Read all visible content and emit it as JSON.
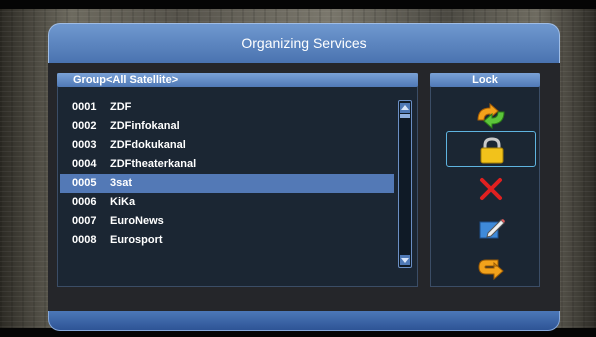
{
  "header": {
    "title": "Organizing Services"
  },
  "group": {
    "label": "Group<All Satellite>"
  },
  "services": [
    {
      "num": "0001",
      "name": "ZDF"
    },
    {
      "num": "0002",
      "name": "ZDFinfokanal"
    },
    {
      "num": "0003",
      "name": "ZDFdokukanal"
    },
    {
      "num": "0004",
      "name": "ZDFtheaterkanal"
    },
    {
      "num": "0005",
      "name": "3sat"
    },
    {
      "num": "0006",
      "name": "KiKa"
    },
    {
      "num": "0007",
      "name": "EuroNews"
    },
    {
      "num": "0008",
      "name": "Eurosport"
    }
  ],
  "selected_index": 4,
  "actions_panel": {
    "title": "Lock"
  },
  "actions": [
    {
      "icon": "move-arrows-icon"
    },
    {
      "icon": "lock-icon",
      "active": true
    },
    {
      "icon": "delete-x-icon"
    },
    {
      "icon": "rename-pencil-icon"
    },
    {
      "icon": "return-arrow-icon"
    }
  ],
  "colors": {
    "accent": "#5379b6",
    "panel": "#1b2633",
    "lock_yellow": "#f2c21b",
    "delete_red": "#e02020"
  }
}
